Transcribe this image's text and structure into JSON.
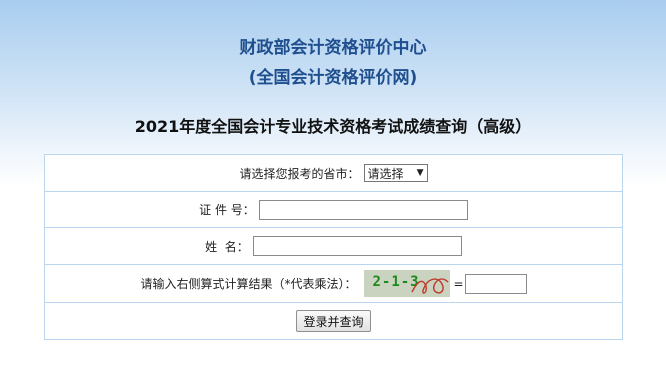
{
  "header": {
    "org_line1": "财政部会计资格评价中心",
    "org_line2": "(全国会计资格评价网)",
    "exam_title": "2021年度全国会计专业技术资格考试成绩查询（高级）"
  },
  "form": {
    "province_label": "请选择您报考的省市：",
    "province_selected": "请选择",
    "id_label": "证 件 号：",
    "id_value": "",
    "name_label": "姓  名：",
    "name_value": "",
    "captcha_label": "请输入右侧算式计算结果（*代表乘法）：",
    "captcha_text": "2-1-3",
    "equals": "=",
    "captcha_value": "",
    "submit_label": "登录并查询"
  },
  "colors": {
    "org_title": "#1f4f8e",
    "table_border": "#b9d6ee",
    "captcha_text": "#1a8a1a"
  }
}
